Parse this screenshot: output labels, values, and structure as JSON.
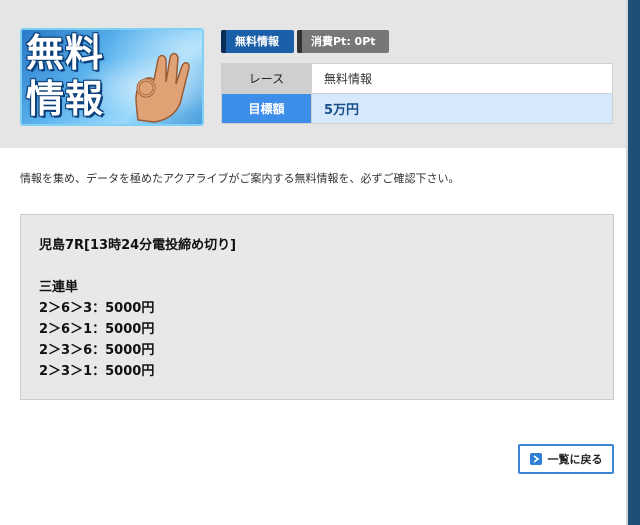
{
  "banner": {
    "line1": "無料",
    "line2": "情報"
  },
  "tags": {
    "free_label": "無料情報",
    "points_label": "消費Pt: 0Pt"
  },
  "info": {
    "rows": [
      {
        "label": "レース",
        "value": "無料情報"
      },
      {
        "label": "目標額",
        "value": "5万円"
      }
    ]
  },
  "intro_text": "情報を集め、データを極めたアクアライブがご案内する無料情報を、必ずご確認下さい。",
  "content": {
    "race_title": "児島7R[13時24分電投締め切り]",
    "bet_type": "三連単",
    "bets": [
      "2＞6＞3：5000円",
      "2＞6＞1：5000円",
      "2＞3＞6：5000円",
      "2＞3＞1：5000円"
    ]
  },
  "back_button": {
    "label": "一覧に戻る"
  },
  "colors": {
    "accent_blue": "#3d8ee8",
    "tag_blue": "#1a5fa8",
    "tag_gray": "#777777",
    "header_bg": "#e5e5e5",
    "content_bg": "#e8e8e8"
  }
}
